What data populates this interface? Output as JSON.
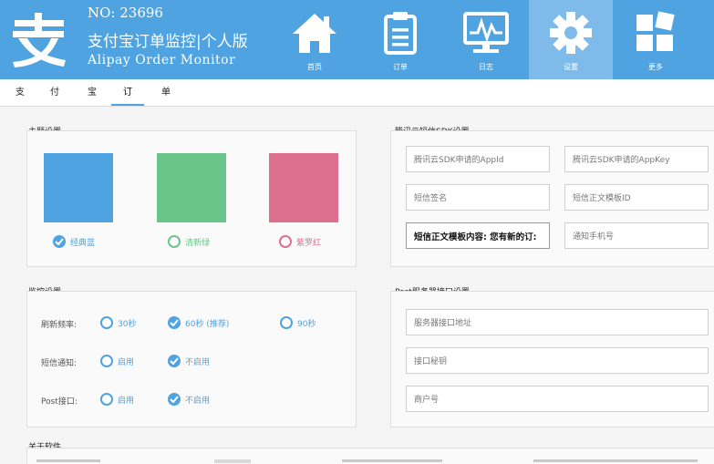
{
  "header": {
    "no": "NO: 23696",
    "title": "支付宝订单监控|个人版",
    "subtitle": "Alipay Order Monitor"
  },
  "nav": [
    {
      "label": "首页",
      "icon": "home-icon"
    },
    {
      "label": "订单",
      "icon": "clipboard-icon"
    },
    {
      "label": "日志",
      "icon": "monitor-chart-icon"
    },
    {
      "label": "设置",
      "icon": "gear-icon",
      "active": true
    },
    {
      "label": "更多",
      "icon": "tiles-icon"
    }
  ],
  "tabs": [
    "支",
    "付",
    "宝",
    "订",
    "单"
  ],
  "colors": {
    "header": "#4ea3e0",
    "theme_blue": "#4ea3e0",
    "theme_green": "#69c58a",
    "theme_red": "#dc6f8e"
  },
  "theme": {
    "title": "主题设置",
    "options": [
      {
        "label": "经典蓝",
        "color": "#4ea3e0",
        "selected": true
      },
      {
        "label": "清新绿",
        "color": "#69c58a",
        "selected": false
      },
      {
        "label": "紫罗红",
        "color": "#dc6f8e",
        "selected": false
      }
    ]
  },
  "monitor": {
    "title": "监控设置",
    "refresh_label": "刷新频率:",
    "refresh_options": [
      {
        "label": "30秒",
        "selected": false
      },
      {
        "label": "60秒 (推荐)",
        "selected": true
      },
      {
        "label": "90秒",
        "selected": false
      }
    ],
    "sms_label": "短信通知:",
    "sms_options": [
      {
        "label": "启用",
        "selected": false
      },
      {
        "label": "不启用",
        "selected": true
      }
    ],
    "post_label": "Post接口:",
    "post_options": [
      {
        "label": "启用",
        "selected": false
      },
      {
        "label": "不启用",
        "selected": true
      }
    ]
  },
  "sms": {
    "title": "腾讯云短信SDK设置",
    "appid_placeholder": "腾讯云SDK申请的AppId",
    "appkey_placeholder": "腾讯云SDK申请的AppKey",
    "sign_placeholder": "短信签名",
    "template_placeholder": "短信正文模板ID",
    "content_value": "短信正文模板内容: 您有新的订:",
    "phone_placeholder": "通知手机号"
  },
  "post": {
    "title": "Post服务器接口设置",
    "url_placeholder": "服务器接口地址",
    "secret_placeholder": "接口秘钥",
    "merchant_placeholder": "商户号"
  },
  "about": {
    "title": "关于软件"
  }
}
